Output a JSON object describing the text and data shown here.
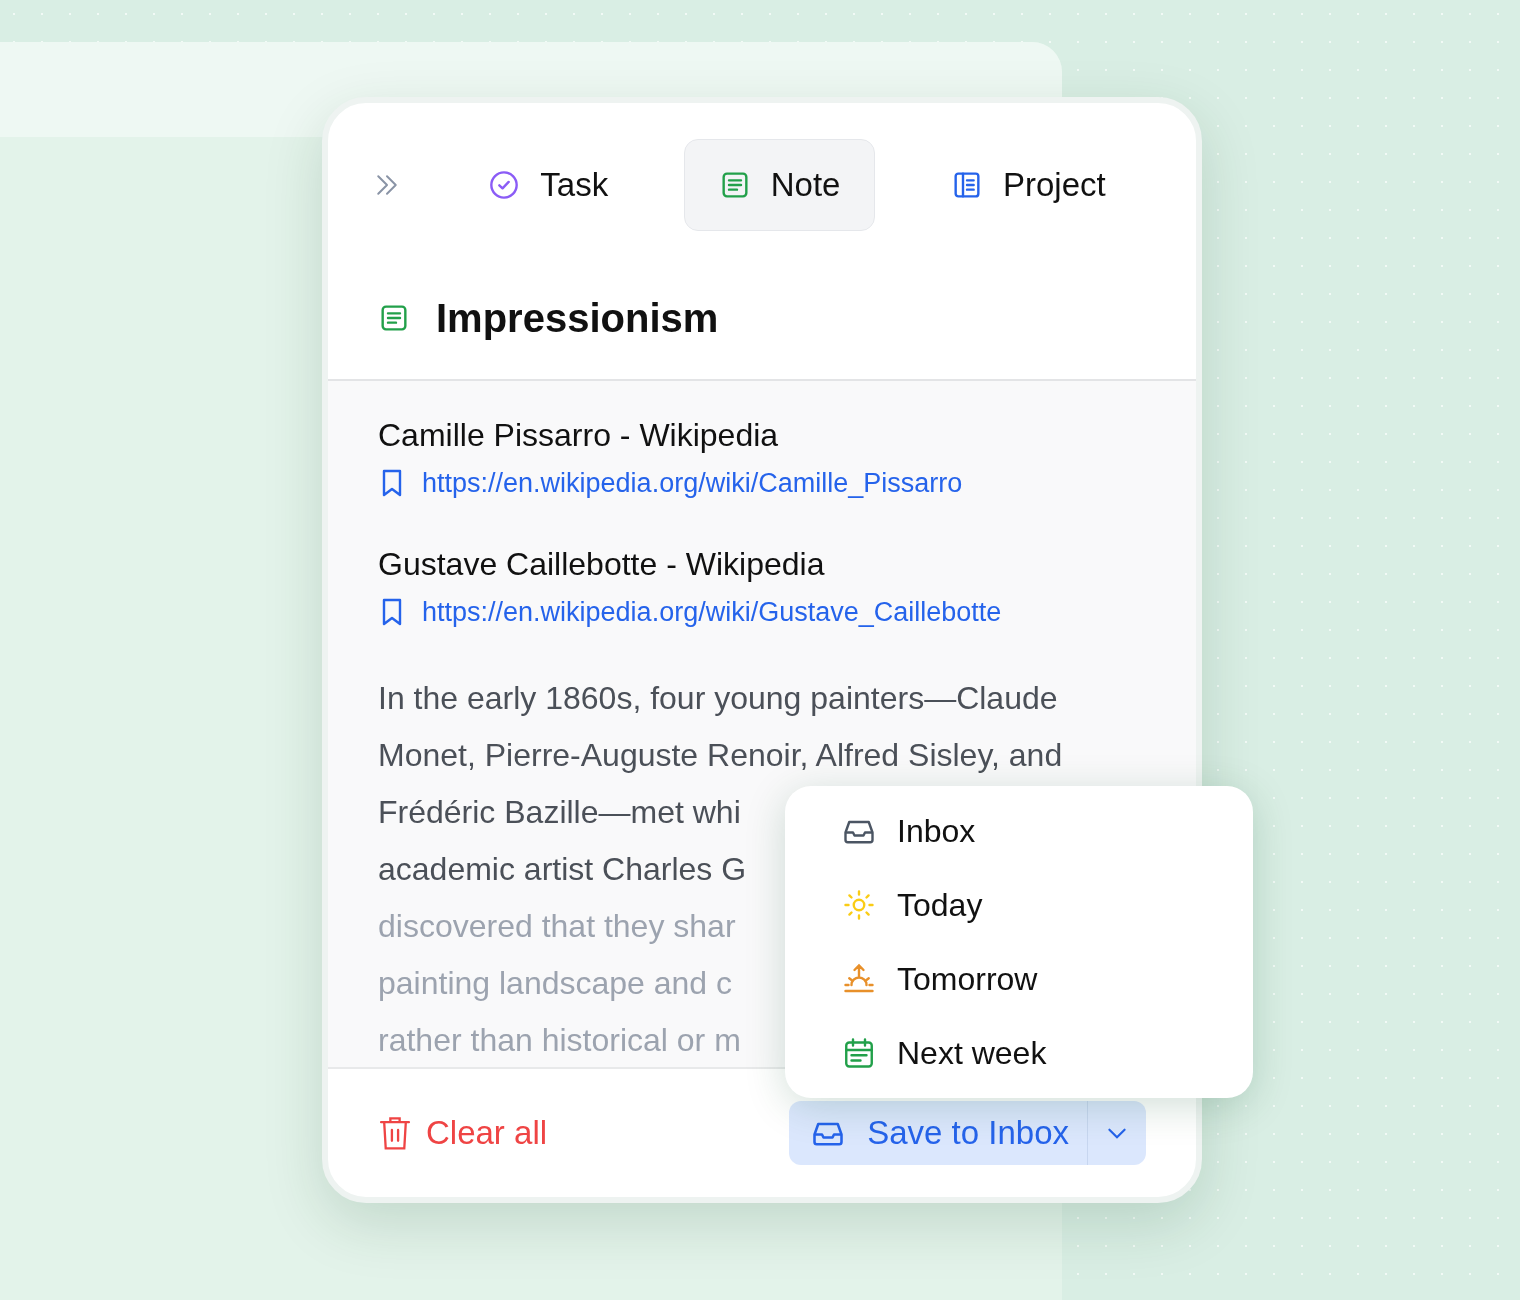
{
  "tabs": [
    {
      "label": "Task",
      "selected": false
    },
    {
      "label": "Note",
      "selected": true
    },
    {
      "label": "Project",
      "selected": false
    }
  ],
  "note": {
    "title": "Impressionism"
  },
  "links": [
    {
      "title": "Camille Pissarro - Wikipedia",
      "url": "https://en.wikipedia.org/wiki/Camille_Pissarro"
    },
    {
      "title": "Gustave Caillebotte - Wikipedia",
      "url": "https://en.wikipedia.org/wiki/Gustave_Caillebotte"
    }
  ],
  "body_lines": [
    "In the early 1860s, four young painters—Claude",
    "Monet, Pierre-Auguste Renoir, Alfred Sisley, and",
    "Frédéric Bazille—met whi",
    "academic artist Charles G",
    "discovered that they shar",
    "painting landscape and c",
    "rather than historical or m"
  ],
  "footer": {
    "clear": "Clear all",
    "save": "Save to Inbox"
  },
  "menu": [
    {
      "label": "Inbox"
    },
    {
      "label": "Today"
    },
    {
      "label": "Tomorrow"
    },
    {
      "label": "Next week"
    }
  ]
}
